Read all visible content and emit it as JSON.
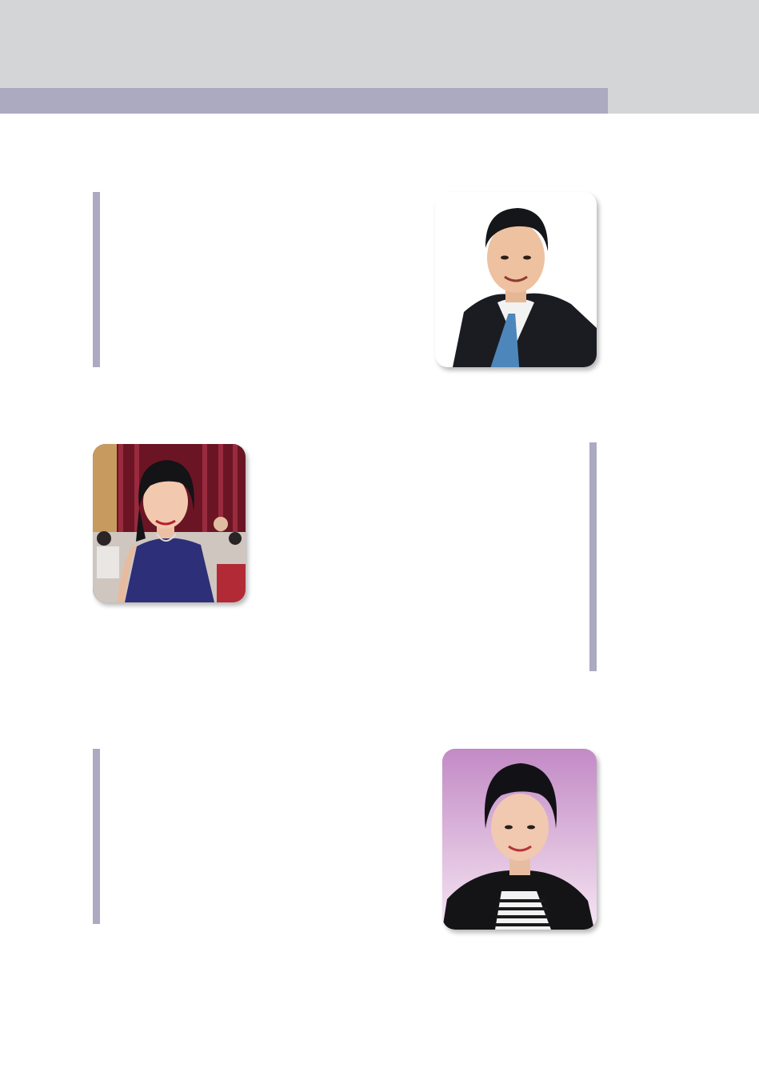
{
  "header": {
    "band_color": "#abaac0",
    "background_color": "#d4d5d7"
  },
  "sections": [
    {
      "photo": {
        "icon": "portrait-man-suit-icon",
        "background": "#ffffff"
      }
    },
    {
      "photo": {
        "icon": "portrait-woman-event-icon",
        "background": "#7a1a2a"
      }
    },
    {
      "photo": {
        "icon": "portrait-woman-pink-icon",
        "background": "#c89ac8"
      }
    }
  ]
}
